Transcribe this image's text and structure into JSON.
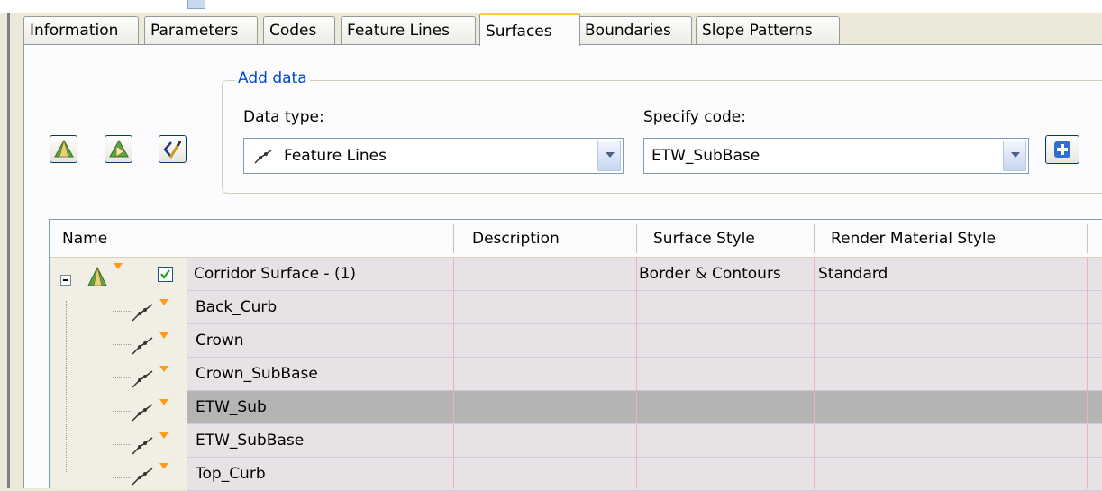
{
  "tabs": [
    "Information",
    "Parameters",
    "Codes",
    "Feature Lines",
    "Surfaces",
    "Boundaries",
    "Slope Patterns"
  ],
  "active_tab": "Surfaces",
  "add_data": {
    "legend": "Add data",
    "data_type_label": "Data type:",
    "data_type_value": "Feature Lines",
    "specify_code_label": "Specify code:",
    "specify_code_value": "ETW_SubBase"
  },
  "left_buttons": {
    "icons": [
      "create-surface-icon",
      "create-surface-from-corridor-icon",
      "edit-surface-icon"
    ]
  },
  "add_button_icon": "plus-icon",
  "grid": {
    "columns": [
      "Name",
      "Description",
      "Surface Style",
      "Render Material Style"
    ],
    "rows": [
      {
        "name": "Corridor Surface - (1)",
        "description": "",
        "surface_style": "Border & Contours",
        "render_material": "Standard",
        "level": 0,
        "checked": true,
        "selected": false
      },
      {
        "name": "Back_Curb",
        "description": "",
        "surface_style": "",
        "render_material": "",
        "level": 1,
        "selected": false
      },
      {
        "name": "Crown",
        "description": "",
        "surface_style": "",
        "render_material": "",
        "level": 1,
        "selected": false
      },
      {
        "name": "Crown_SubBase",
        "description": "",
        "surface_style": "",
        "render_material": "",
        "level": 1,
        "selected": false
      },
      {
        "name": "ETW_Sub",
        "description": "",
        "surface_style": "",
        "render_material": "",
        "level": 1,
        "selected": true
      },
      {
        "name": "ETW_SubBase",
        "description": "",
        "surface_style": "",
        "render_material": "",
        "level": 1,
        "selected": false
      },
      {
        "name": "Top_Curb",
        "description": "",
        "surface_style": "",
        "render_material": "",
        "level": 1,
        "selected": false
      }
    ]
  },
  "colors": {
    "active_tab_accent": "#ffc83c",
    "legend_text": "#0046d5",
    "selected_row": "#b4b4b4",
    "row_bg": "#e8e2e6"
  }
}
